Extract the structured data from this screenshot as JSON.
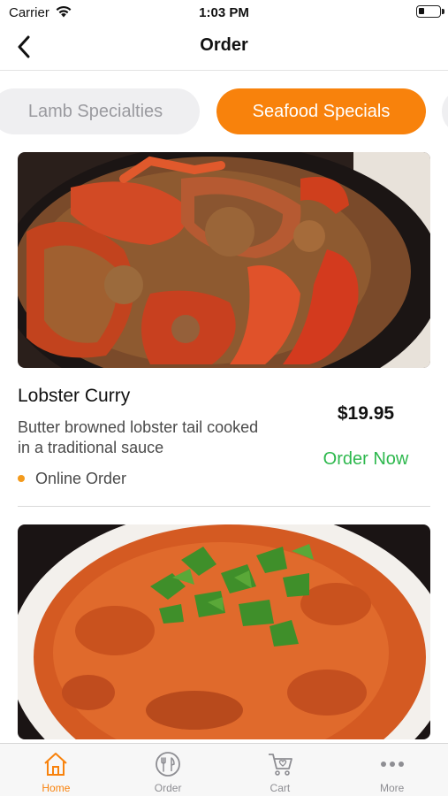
{
  "status_bar": {
    "carrier": "Carrier",
    "time": "1:03 PM"
  },
  "nav": {
    "title": "Order"
  },
  "categories": [
    {
      "label": "Lamb Specialties",
      "active": false
    },
    {
      "label": "Seafood Specials",
      "active": true
    }
  ],
  "menu_items": [
    {
      "name": "Lobster Curry",
      "description": "Butter browned lobster tail cooked in a traditional sauce",
      "price": "$19.95",
      "action": "Order Now",
      "tag": "Online Order"
    }
  ],
  "tab_bar": {
    "items": [
      {
        "label": "Home",
        "icon": "home-icon",
        "active": true
      },
      {
        "label": "Order",
        "icon": "plate-cutlery-icon",
        "active": false
      },
      {
        "label": "Cart",
        "icon": "cart-icon",
        "active": false
      },
      {
        "label": "More",
        "icon": "more-dots-icon",
        "active": false
      }
    ]
  },
  "colors": {
    "accent": "#f8820c",
    "order_now": "#2db84d",
    "chip_inactive_bg": "#efeff1",
    "chip_inactive_text": "#9a9a9f",
    "tag_dot": "#f39a1c"
  }
}
